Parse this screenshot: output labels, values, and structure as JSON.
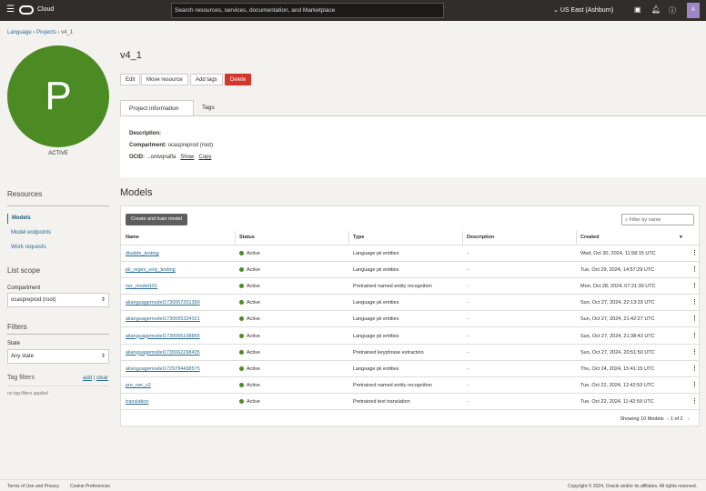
{
  "header": {
    "brand": "Cloud",
    "search_placeholder": "Search resources, services, documentation, and Marketplace",
    "region": "US East (Ashburn)",
    "avatar": "A"
  },
  "breadcrumb": [
    "Language",
    "Projects",
    "v4_1"
  ],
  "project": {
    "initial": "P",
    "state": "ACTIVE",
    "title": "v4_1",
    "buttons": {
      "edit": "Edit",
      "move": "Move resource",
      "add_tags": "Add tags",
      "delete": "Delete"
    },
    "tabs": [
      "Project information",
      "Tags"
    ],
    "info": {
      "description_label": "Description:",
      "compartment_label": "Compartment:",
      "compartment": "ocaspreprod (root)",
      "ocid_label": "OCID:",
      "ocid": "...ontvqnafla",
      "show": "Show",
      "copy": "Copy"
    }
  },
  "sidebar": {
    "resources": "Resources",
    "nav": [
      "Models",
      "Model endpoints",
      "Work requests"
    ],
    "list_scope": "List scope",
    "compartment_label": "Compartment",
    "compartment": "ocaspreprod (root)",
    "filters": "Filters",
    "state_label": "State",
    "state": "Any state",
    "tag_filters": "Tag filters",
    "add": "add",
    "clear": "clear",
    "no_tags": "no tag filters applied"
  },
  "models": {
    "heading": "Models",
    "create": "Create and train model",
    "filter_placeholder": "Filter by name",
    "columns": [
      "Name",
      "Status",
      "Type",
      "Description",
      "Created"
    ],
    "rows": [
      {
        "name": "disable_testing",
        "status": "Active",
        "type": "Language pii entities",
        "description": "-",
        "created": "Wed, Oct 30, 2024, 11:58:15 UTC"
      },
      {
        "name": "pii_regex_only_testing",
        "status": "Active",
        "type": "Language pii entities",
        "description": "-",
        "created": "Tue, Oct 29, 2024, 14:57:29 UTC"
      },
      {
        "name": "ner_model101",
        "status": "Active",
        "type": "Pretrained named entity recognition",
        "description": "-",
        "created": "Mon, Oct 28, 2024, 07:21:39 UTC"
      },
      {
        "name": "ailanguagemodel1730067201399",
        "status": "Active",
        "type": "Language pii entities",
        "description": "-",
        "created": "Sun, Oct 27, 2024, 22:13:33 UTC"
      },
      {
        "name": "ailanguagemodel1730065334101",
        "status": "Active",
        "type": "Language pii entities",
        "description": "-",
        "created": "Sun, Oct 27, 2024, 21:42:27 UTC"
      },
      {
        "name": "ailanguagemodel1730065108865",
        "status": "Active",
        "type": "Language pii entities",
        "description": "-",
        "created": "Sun, Oct 27, 2024, 21:38:43 UTC"
      },
      {
        "name": "ailanguagemodel1730062298435",
        "status": "Active",
        "type": "Pretrained keyphrase extraction",
        "description": "-",
        "created": "Sun, Oct 27, 2024, 20:51:50 UTC"
      },
      {
        "name": "ailanguagemodel1729784438575",
        "status": "Active",
        "type": "Language pii entities",
        "description": "-",
        "created": "Thu, Oct 24, 2024, 15:41:15 UTC"
      },
      {
        "name": "pre_ner_v2",
        "status": "Active",
        "type": "Pretrained named entity recognition",
        "description": "-",
        "created": "Tue, Oct 22, 2024, 12:42:53 UTC"
      },
      {
        "name": "translation",
        "status": "Active",
        "type": "Pretrained text translation",
        "description": "-",
        "created": "Tue, Oct 22, 2024, 11:42:59 UTC"
      }
    ],
    "showing": "Showing 10 Models",
    "page": "1 of 2"
  },
  "footer": {
    "terms": "Terms of Use and Privacy",
    "cookies": "Cookie Preferences",
    "copyright": "Copyright © 2024, Oracle and/or its affiliates. All rights reserved."
  }
}
